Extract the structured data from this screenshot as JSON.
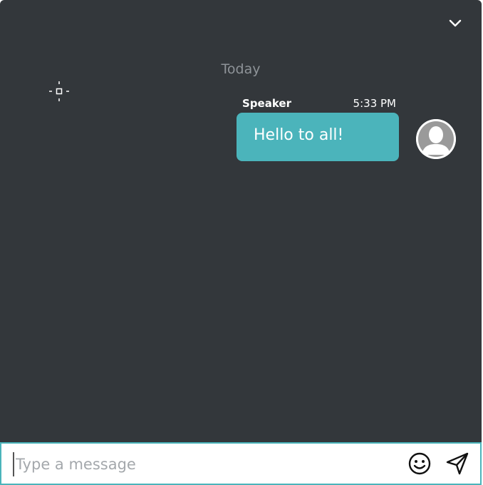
{
  "chat": {
    "date_separator": "Today",
    "messages": [
      {
        "sender": "Speaker",
        "time": "5:33 PM",
        "text": "Hello to all!"
      }
    ]
  },
  "composer": {
    "placeholder": "Type a message"
  },
  "icons": {
    "collapse": "chevron-down-icon",
    "avatar": "user-avatar-icon",
    "emoji": "smiley-icon",
    "send": "send-icon",
    "cursor": "crosshair-icon"
  },
  "colors": {
    "background": "#33373b",
    "bubble": "#4bb4bb",
    "accent_border": "#4bb4bb",
    "date_text": "#8e9398"
  }
}
